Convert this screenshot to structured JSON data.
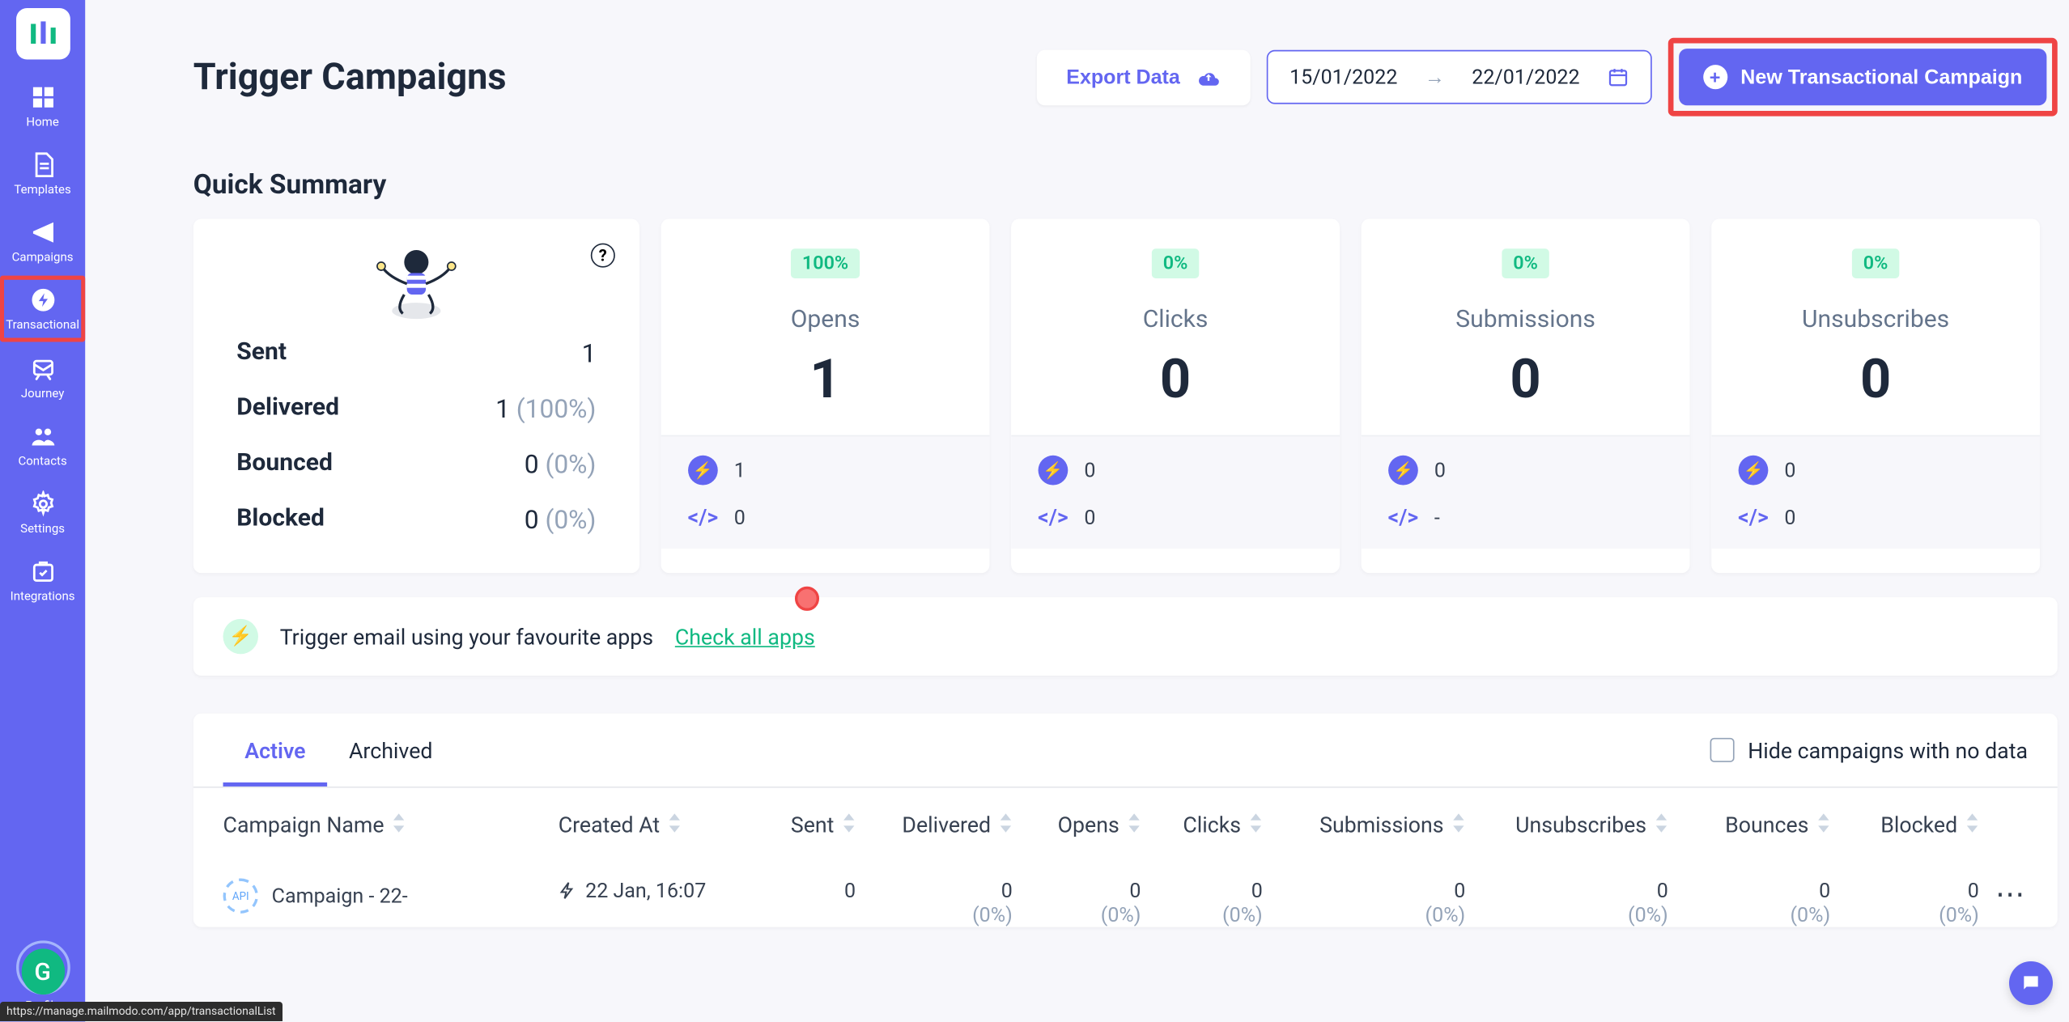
{
  "sidebar": {
    "items": [
      {
        "label": "Home"
      },
      {
        "label": "Templates"
      },
      {
        "label": "Campaigns"
      },
      {
        "label": "Transactional"
      },
      {
        "label": "Journey"
      },
      {
        "label": "Contacts"
      },
      {
        "label": "Settings"
      },
      {
        "label": "Integrations"
      }
    ],
    "profile_label": "Profile",
    "avatar_letter": "G"
  },
  "header": {
    "title": "Trigger Campaigns",
    "export_label": "Export Data",
    "date_from": "15/01/2022",
    "date_to": "22/01/2022",
    "new_label": "New Transactional Campaign"
  },
  "summary": {
    "title": "Quick Summary",
    "sent_rows": [
      {
        "label": "Sent",
        "value": "1",
        "pct": ""
      },
      {
        "label": "Delivered",
        "value": "1",
        "pct": "(100%)"
      },
      {
        "label": "Bounced",
        "value": "0",
        "pct": "(0%)"
      },
      {
        "label": "Blocked",
        "value": "0",
        "pct": "(0%)"
      }
    ],
    "metrics": [
      {
        "badge": "100%",
        "label": "Opens",
        "value": "1",
        "bolt": "1",
        "code": "0"
      },
      {
        "badge": "0%",
        "label": "Clicks",
        "value": "0",
        "bolt": "0",
        "code": "0"
      },
      {
        "badge": "0%",
        "label": "Submissions",
        "value": "0",
        "bolt": "0",
        "code": "-"
      },
      {
        "badge": "0%",
        "label": "Unsubscribes",
        "value": "0",
        "bolt": "0",
        "code": "0"
      }
    ]
  },
  "banner": {
    "text": "Trigger email using your favourite apps",
    "link": "Check all apps"
  },
  "table": {
    "tabs": [
      {
        "label": "Active",
        "active": true
      },
      {
        "label": "Archived",
        "active": false
      }
    ],
    "hide_label": "Hide campaigns with no data",
    "columns": [
      "Campaign Name",
      "Created At",
      "Sent",
      "Delivered",
      "Opens",
      "Clicks",
      "Submissions",
      "Unsubscribes",
      "Bounces",
      "Blocked"
    ],
    "rows": [
      {
        "name": "Campaign - 22-",
        "created": "22 Jan, 16:07",
        "sent": "0",
        "delivered": {
          "v": "0",
          "p": "(0%)"
        },
        "opens": {
          "v": "0",
          "p": "(0%)"
        },
        "clicks": {
          "v": "0",
          "p": "(0%)"
        },
        "submissions": {
          "v": "0",
          "p": "(0%)"
        },
        "unsubscribes": {
          "v": "0",
          "p": "(0%)"
        },
        "bounces": {
          "v": "0",
          "p": "(0%)"
        },
        "blocked": {
          "v": "0",
          "p": "(0%)"
        }
      }
    ]
  },
  "statusbar": "https://manage.mailmodo.com/app/transactionalList"
}
